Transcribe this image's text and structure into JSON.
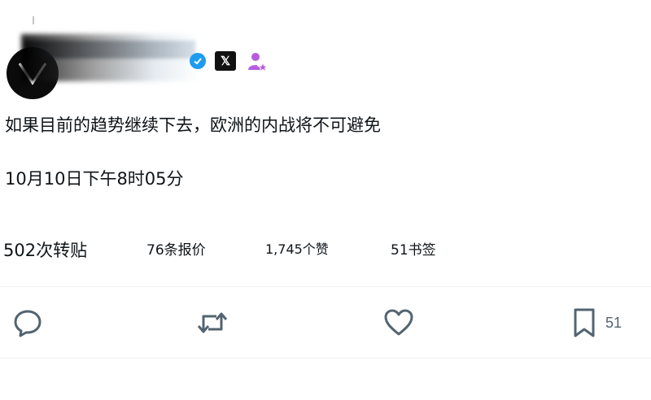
{
  "tweet": {
    "text": "如果目前的趋势继续下去，欧洲的内战将不可避免",
    "time": "10月10日下午8时05分"
  },
  "stats": {
    "retweets": "502次转贴",
    "quotes": "76条报价",
    "likes": "1,745个赞",
    "bookmarks": "51书签"
  },
  "actions": {
    "bookmark_count": "51"
  },
  "icons": {
    "verified": "verified-badge-icon",
    "platform": "x-logo-icon",
    "affiliate": "affiliate-person-icon",
    "reply": "reply-icon",
    "retweet": "retweet-icon",
    "like": "heart-icon",
    "bookmark": "bookmark-icon"
  },
  "colors": {
    "verified": "#1d9bf0",
    "affiliate": "#b75ce0",
    "icon_gray": "#536471",
    "text": "#0f1419"
  }
}
